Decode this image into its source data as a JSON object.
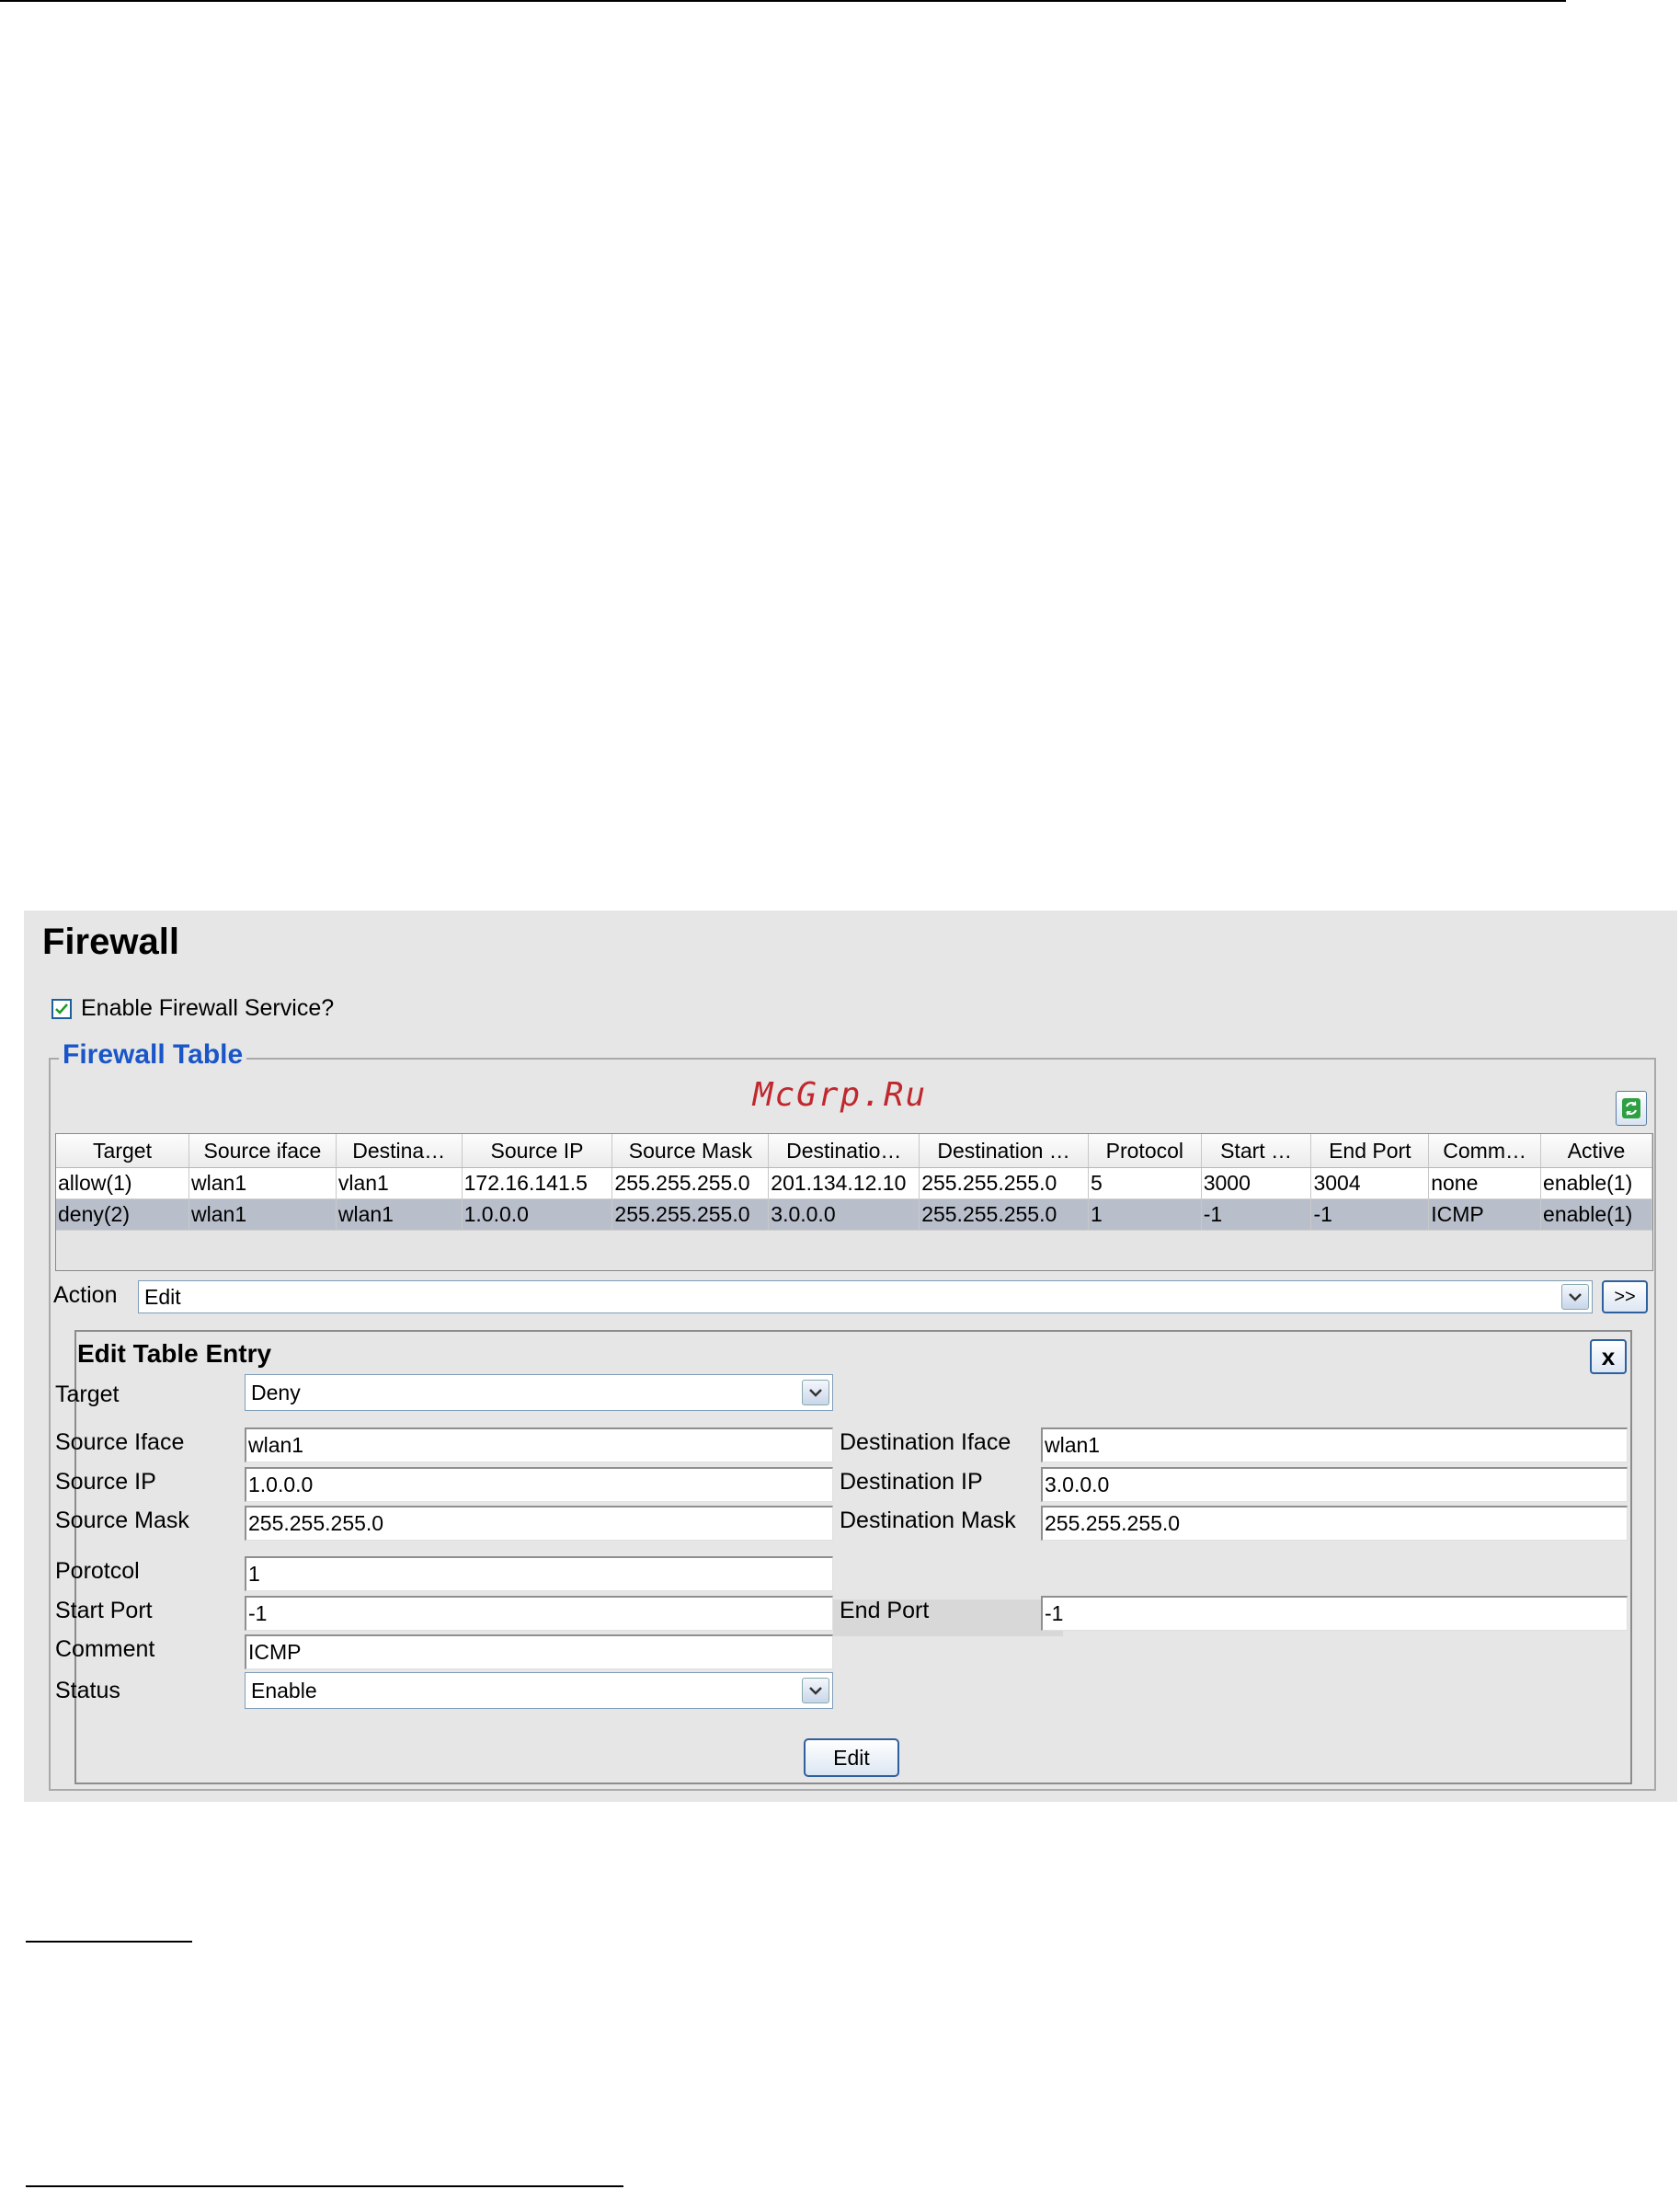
{
  "watermark": "McGrp.Ru",
  "firewall": {
    "title": "Firewall",
    "enable_label": "Enable Firewall Service?",
    "enable_checked": true,
    "table_legend": "Firewall Table",
    "columns": [
      "Target",
      "Source iface",
      "Destina…",
      "Source IP",
      "Source Mask",
      "Destinatio…",
      "Destination …",
      "Protocol",
      "Start …",
      "End Port",
      "Comm…",
      "Active"
    ],
    "rows": [
      [
        "allow(1)",
        "wlan1",
        "vlan1",
        "172.16.141.5",
        "255.255.255.0",
        "201.134.12.10",
        "255.255.255.0",
        "5",
        "3000",
        "3004",
        "none",
        "enable(1)"
      ],
      [
        "deny(2)",
        "wlan1",
        "wlan1",
        "1.0.0.0",
        "255.255.255.0",
        "3.0.0.0",
        "255.255.255.0",
        "1",
        "-1",
        "-1",
        "ICMP",
        "enable(1)"
      ]
    ],
    "selected_row": 1,
    "action_label": "Action",
    "action_value": "Edit",
    "go_label": ">>"
  },
  "edit": {
    "title": "Edit Table Entry",
    "close_label": "x",
    "target_label": "Target",
    "target_value": "Deny",
    "source_iface_label": "Source Iface",
    "source_iface_value": "wlan1",
    "dest_iface_label": "Destination Iface",
    "dest_iface_value": "wlan1",
    "source_ip_label": "Source IP",
    "source_ip_value": "1.0.0.0",
    "dest_ip_label": "Destination IP",
    "dest_ip_value": "3.0.0.0",
    "source_mask_label": "Source Mask",
    "source_mask_value": "255.255.255.0",
    "dest_mask_label": "Destination Mask",
    "dest_mask_value": "255.255.255.0",
    "protocol_label": "Porotcol",
    "protocol_value": "1",
    "start_port_label": "Start Port",
    "start_port_value": "-1",
    "end_port_label": "End Port",
    "end_port_value": "-1",
    "comment_label": "Comment",
    "comment_value": "ICMP",
    "status_label": "Status",
    "status_value": "Enable",
    "submit_label": "Edit"
  },
  "colors": {
    "legend": "#1a56c8",
    "watermark": "#c0282e",
    "panel_bg": "#e6e6e6",
    "selected_row": "#b8bfcb"
  }
}
